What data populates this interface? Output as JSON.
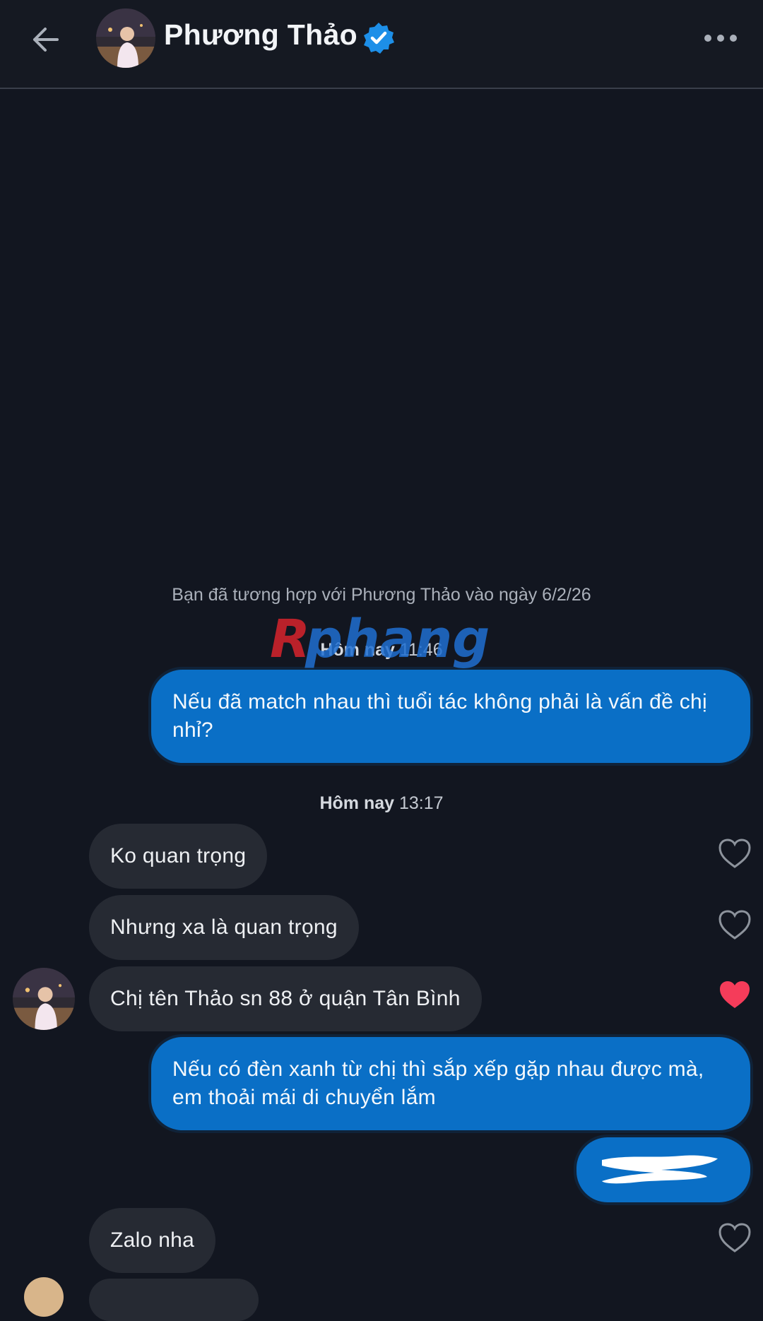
{
  "header": {
    "contact_name": "Phương Thảo",
    "back_icon": "arrow-left-icon",
    "verified_icon": "verified-badge-icon",
    "more_icon": "more-horizontal-icon"
  },
  "colors": {
    "background": "#121620",
    "outgoing_bubble": "#0a6fc6",
    "incoming_bubble": "#262a33",
    "verified": "#1d8fe8",
    "heart_liked": "#f53c5a"
  },
  "match_notice": "Bạn đã tương hợp với Phương Thảo vào ngày 6/2/26",
  "watermark_text": "Rphang",
  "timestamps": [
    {
      "day": "Hôm nay",
      "time": "11:46"
    },
    {
      "day": "Hôm nay",
      "time": "13:17"
    }
  ],
  "messages": [
    {
      "direction": "outgoing",
      "text": "Nếu đã match nhau thì tuổi tác không phải là vấn đề chị nhỉ?"
    },
    {
      "direction": "incoming",
      "text": "Ko quan trọng",
      "liked": false
    },
    {
      "direction": "incoming",
      "text": "Nhưng xa là quan trọng",
      "liked": false
    },
    {
      "direction": "incoming",
      "text": "Chị tên Thảo sn 88 ở quận Tân Bình",
      "liked": true
    },
    {
      "direction": "outgoing",
      "text": "Nếu có đèn xanh từ chị thì sắp xếp gặp nhau được mà, em thoải mái di chuyển lắm"
    },
    {
      "direction": "outgoing",
      "text": "",
      "redacted": true
    },
    {
      "direction": "incoming",
      "text": "Zalo nha",
      "liked": false
    }
  ]
}
